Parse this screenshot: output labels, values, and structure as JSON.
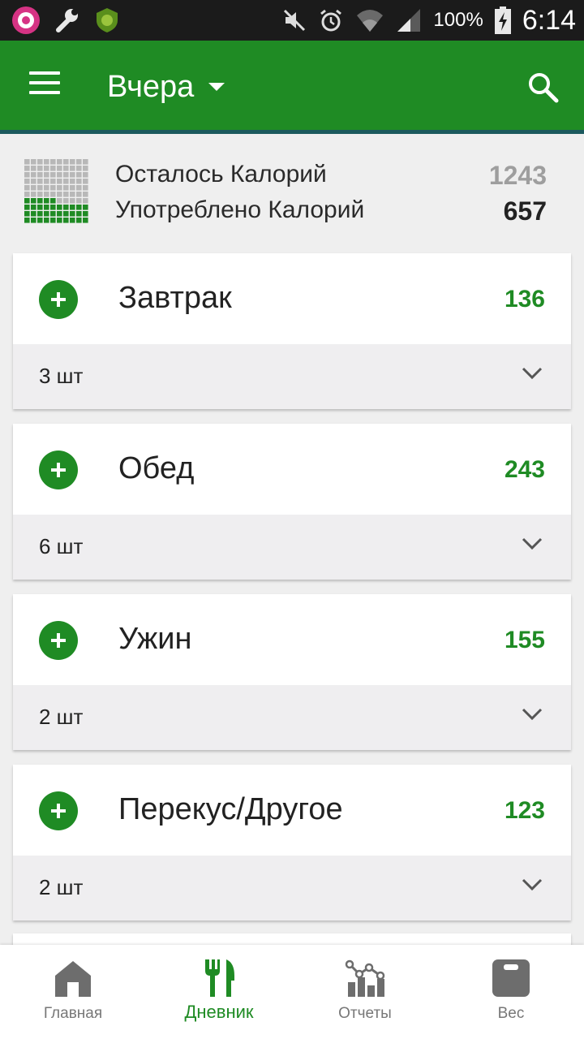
{
  "status_bar": {
    "battery": "100%",
    "time": "6:14"
  },
  "header": {
    "date_label": "Вчера"
  },
  "summary": {
    "remaining_label": "Осталось Калорий",
    "remaining_value": "1243",
    "consumed_label": "Употреблено Калорий",
    "consumed_value": "657"
  },
  "meals": [
    {
      "name": "Завтрак",
      "calories": "136",
      "count": "3 шт"
    },
    {
      "name": "Обед",
      "calories": "243",
      "count": "6 шт"
    },
    {
      "name": "Ужин",
      "calories": "155",
      "count": "2 шт"
    },
    {
      "name": "Перекус/Другое",
      "calories": "123",
      "count": "2 шт"
    }
  ],
  "nav": [
    {
      "label": "Главная",
      "icon": "home-icon"
    },
    {
      "label": "Дневник",
      "icon": "fork-knife-icon",
      "active": true
    },
    {
      "label": "Отчеты",
      "icon": "chart-icon"
    },
    {
      "label": "Вес",
      "icon": "scale-icon"
    }
  ],
  "colors": {
    "brand": "#1f8b24",
    "remaining": "#9e9e9e",
    "status_bar": "#1b1b1b"
  }
}
